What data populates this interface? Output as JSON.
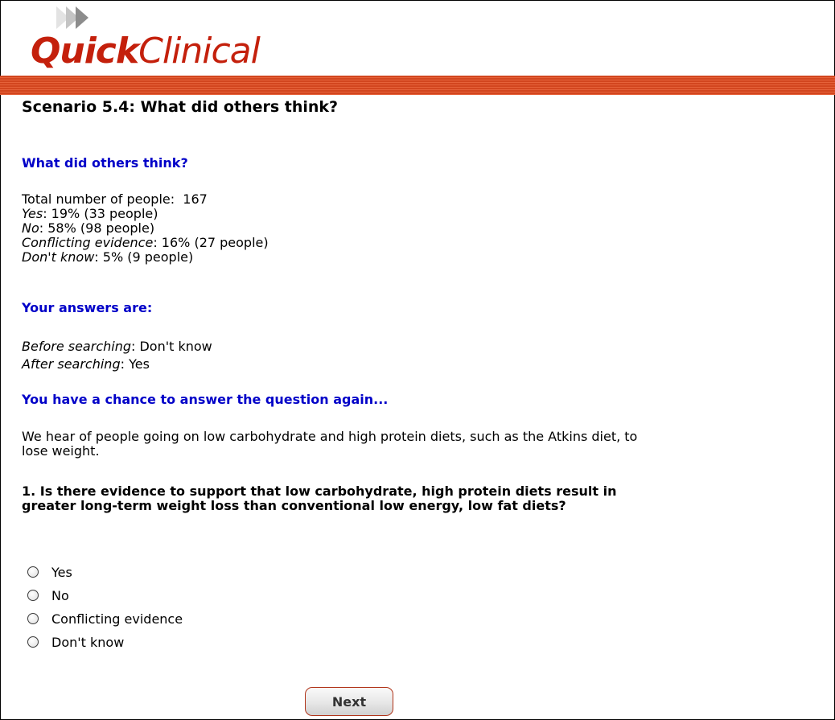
{
  "logo": {
    "part1": "Quick",
    "part2": "Clinical"
  },
  "page_title": "Scenario 5.4: What did others think?",
  "others": {
    "heading": "What did others think?",
    "total_label": "Total number of people:",
    "total_value": "167",
    "results": [
      {
        "label": "Yes",
        "value": ": 19% (33 people)"
      },
      {
        "label": "No",
        "value": ": 58% (98 people)"
      },
      {
        "label": "Conflicting evidence",
        "value": ": 16% (27 people)"
      },
      {
        "label": "Don't know",
        "value": ": 5% (9 people)"
      }
    ]
  },
  "your_answers": {
    "heading": "Your answers are:",
    "before_label": "Before searching",
    "before_value": ":  Don't know",
    "after_label": "After searching",
    "after_value": ":  Yes"
  },
  "again": {
    "heading": "You have a chance to answer the question again...",
    "intro": "We hear of people going on low carbohydrate and high protein diets, such as the Atkins diet, to lose weight.",
    "question": "1. Is there evidence to support that low carbohydrate, high protein diets result in greater long-term weight loss than conventional low energy, low fat diets?",
    "options": [
      "Yes",
      "No",
      "Conflicting evidence",
      "Don't know"
    ]
  },
  "next_label": "Next"
}
